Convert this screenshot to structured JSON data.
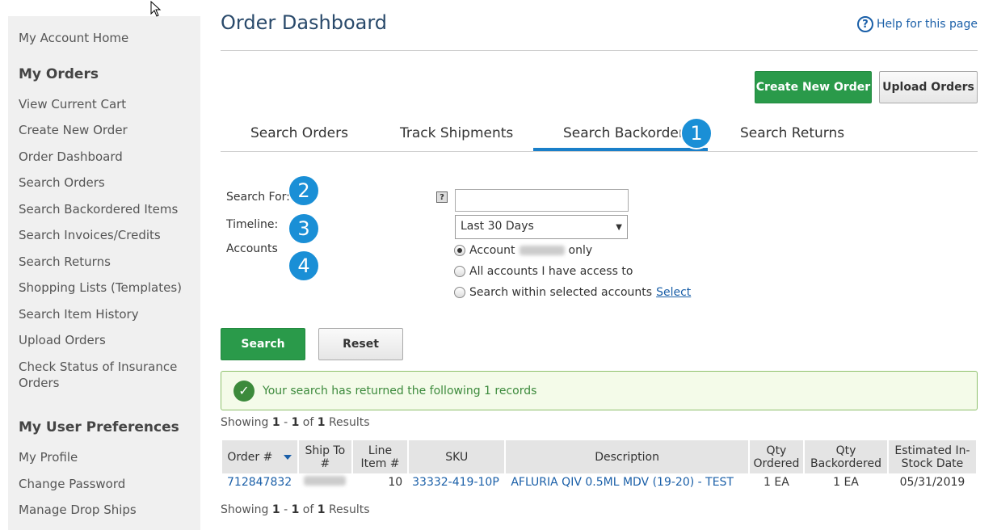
{
  "sidebar": {
    "home": "My Account Home",
    "orders_heading": "My Orders",
    "order_items": [
      "View Current Cart",
      "Create New Order",
      "Order Dashboard",
      "Search Orders",
      "Search Backordered Items",
      "Search Invoices/Credits",
      "Search Returns",
      "Shopping Lists (Templates)",
      "Search Item History",
      "Upload Orders",
      "Check Status of Insurance Orders"
    ],
    "prefs_heading": "My User Preferences",
    "pref_items": [
      "My Profile",
      "Change Password",
      "Manage Drop Ships"
    ]
  },
  "header": {
    "title": "Order Dashboard",
    "help": "Help for this page",
    "create_order": "Create New Order",
    "upload_orders": "Upload Orders"
  },
  "tabs": {
    "search_orders": "Search Orders",
    "track_shipments": "Track Shipments",
    "search_backorders": "Search Backorders",
    "search_returns": "Search Returns",
    "active": "Search Backorders"
  },
  "badges": [
    "1",
    "2",
    "3",
    "4"
  ],
  "form": {
    "search_for_label": "Search For:",
    "timeline_label": "Timeline:",
    "accounts_label": "Accounts",
    "search_value": "",
    "timeline_value": "Last 30 Days",
    "radio_account_prefix": "Account",
    "radio_account_suffix": "only",
    "radio_all": "All accounts I have access to",
    "radio_selected": "Search within selected accounts",
    "select_link": "Select",
    "search_button": "Search",
    "reset_button": "Reset"
  },
  "message": "Your search has returned the following 1 records",
  "showing": {
    "prefix": "Showing",
    "from": "1",
    "to": "1",
    "of": "of",
    "total": "1",
    "suffix": "Results"
  },
  "table": {
    "headers": {
      "order": "Order #",
      "ship_to": "Ship To #",
      "line_item": "Line Item #",
      "sku": "SKU",
      "description": "Description",
      "qty_ordered": "Qty Ordered",
      "qty_backordered": "Qty Backordered",
      "est_date": "Estimated In-Stock Date"
    },
    "rows": [
      {
        "order": "712847832",
        "line_item": "10",
        "sku": "33332-419-10P",
        "description": "AFLURIA QIV 0.5ML MDV (19-20) - TEST",
        "qty_ordered": "1 EA",
        "qty_backordered": "1 EA",
        "est_date": "05/31/2019"
      }
    ]
  },
  "colors": {
    "accent": "#1a8fd6",
    "green": "#2a9a4a",
    "link": "#1a5fa8"
  }
}
